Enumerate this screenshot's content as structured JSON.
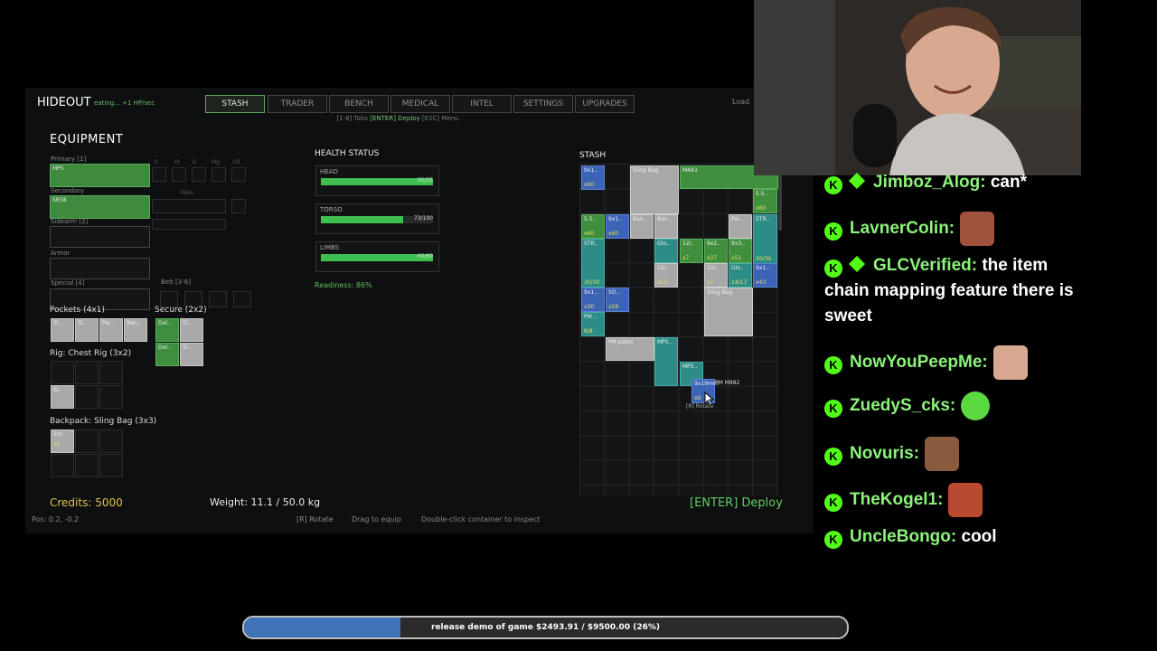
{
  "game": {
    "title": "HIDEOUT",
    "subtitle": "eating... +1 HP/sec",
    "tabs": [
      "STASH",
      "TRADER",
      "BENCH",
      "MEDICAL",
      "INTEL",
      "SETTINGS",
      "UPGRADES"
    ],
    "active_tab": "STASH",
    "hint_prefix": "[1-8] Tabs",
    "hint_deploy": "[ENTER] Deploy",
    "hint_suffix": "[ESC] Menu",
    "load_label": "Load"
  },
  "equipment": {
    "title": "EQUIPMENT",
    "primary_label": "Primary [1]",
    "primary_item": "MP5",
    "secondary_label": "Secondary",
    "secondary_item": "SR58",
    "sidearm_label": "Sidearm [2]",
    "armor_label": "Armor",
    "special_label": "Special [4]",
    "belt_label": "Belt [3-6]",
    "attach_labels": [
      "O",
      "M",
      "G",
      "Mg",
      "UB"
    ],
    "attach_placeholder": "MAG",
    "pockets_label": "Pockets (4x1)",
    "pocket_items": [
      "Sl..",
      "Sl..",
      "Pai..",
      "Ban.."
    ],
    "secure_label": "Secure (2x2)",
    "secure_items": [
      "Dol..",
      "Sl..",
      "Dol..",
      "Sl.."
    ],
    "rig_label": "Rig: Chest Rig (3x2)",
    "rig_items": [
      "Sl.."
    ],
    "backpack_label": "Backpack: Sling Bag (3x3)",
    "backpack_items": [
      {
        "name": "20/..",
        "qty": "x5"
      }
    ]
  },
  "health": {
    "title": "HEALTH STATUS",
    "parts": [
      {
        "label": "HEAD",
        "value": "35/35",
        "pct": 100
      },
      {
        "label": "TORSO",
        "value": "73/100",
        "pct": 73
      },
      {
        "label": "LIMBS",
        "value": "60/60",
        "pct": 100
      }
    ],
    "readiness": "Readiness: 86%"
  },
  "stash": {
    "title": "STASH",
    "items": [
      {
        "name": "9x1..",
        "qty": "x60",
        "color": "blue"
      },
      {
        "name": "Sling Bag",
        "qty": "",
        "color": "gray"
      },
      {
        "name": "M4A1",
        "qty": "",
        "color": "green"
      },
      {
        "name": "5.5..",
        "qty": "x60",
        "color": "green"
      },
      {
        "name": "5.5..",
        "qty": "x60",
        "color": "green"
      },
      {
        "name": "9x1..",
        "qty": "x60",
        "color": "blue"
      },
      {
        "name": "Ban..",
        "qty": "",
        "color": "gray"
      },
      {
        "name": "Ban..",
        "qty": "",
        "color": "gray"
      },
      {
        "name": "Pai..",
        "qty": "",
        "color": "gray"
      },
      {
        "name": "STR..",
        "qty": "30/30",
        "color": "teal"
      },
      {
        "name": "STR..",
        "qty": "30/30",
        "color": "teal"
      },
      {
        "name": "Glo..",
        "qty": "",
        "color": "teal"
      },
      {
        "name": "12/..",
        "qty": "x7",
        "color": "green"
      },
      {
        "name": "9x2..",
        "qty": "x37",
        "color": "green"
      },
      {
        "name": "9x3..",
        "qty": "x51",
        "color": "green"
      },
      {
        "name": "12/..",
        "qty": "x13",
        "color": "gray"
      },
      {
        "name": "12/..",
        "qty": "x7",
        "color": "gray"
      },
      {
        "name": "Glo..",
        "qty": "14/17",
        "color": "teal"
      },
      {
        "name": "9x1..",
        "qty": "x43",
        "color": "blue"
      },
      {
        "name": "9x1..",
        "qty": "x30",
        "color": "blue"
      },
      {
        "name": "SO..",
        "qty": "x59",
        "color": "blue"
      },
      {
        "name": "Sling Bag",
        "qty": "",
        "color": "gray"
      },
      {
        "name": "PM ..",
        "qty": "8/8",
        "color": "teal"
      },
      {
        "name": "PM pistol",
        "qty": "",
        "color": "gray"
      },
      {
        "name": "MP5..",
        "qty": "",
        "color": "teal"
      },
      {
        "name": "MP5..",
        "qty": "",
        "color": "teal"
      },
      {
        "name": "9x19mm",
        "qty": "x6",
        "color": "blue"
      }
    ],
    "tooltip_name": "PM M882",
    "tooltip_hint": "[R] Rotate"
  },
  "footer": {
    "credits": "Credits: 5000",
    "weight": "Weight: 11.1 / 50.0 kg",
    "deploy": "[ENTER] Deploy",
    "pos": "Pos: 0.2, -0.2",
    "hint_rotate": "[R] Rotate",
    "hint_drag": "Drag to equip",
    "hint_inspect": "Double-click container to inspect"
  },
  "chat": {
    "messages": [
      {
        "user": "Jimboz_Alog:",
        "text": "can*",
        "vip": true,
        "emote": ""
      },
      {
        "user": "LavnerColin:",
        "text": "",
        "vip": false,
        "emote": "emote-face"
      },
      {
        "user": "GLCVerified:",
        "text": "the item chain mapping feature there is sweet",
        "vip": true,
        "emote": ""
      },
      {
        "user": "NowYouPeepMe:",
        "text": "",
        "vip": false,
        "emote": "emote-face"
      },
      {
        "user": "ZuedyS_cks:",
        "text": "",
        "vip": false,
        "emote": "emote-frog"
      },
      {
        "user": "Novuris:",
        "text": "",
        "vip": false,
        "emote": "emote-face"
      },
      {
        "user": "TheKogel1:",
        "text": "",
        "vip": false,
        "emote": "emote-face"
      },
      {
        "user": "UncleBongo:",
        "text": "cool",
        "vip": false,
        "emote": ""
      }
    ]
  },
  "goal": {
    "text": "release demo of game $2493.91 / $9500.00 (26%)",
    "progress": 0.26
  },
  "colors": {
    "accent_green": "#5fcf5f",
    "credits_gold": "#e0c04a",
    "kick_green": "#53fc18",
    "goal_blue": "#3f73b8"
  }
}
